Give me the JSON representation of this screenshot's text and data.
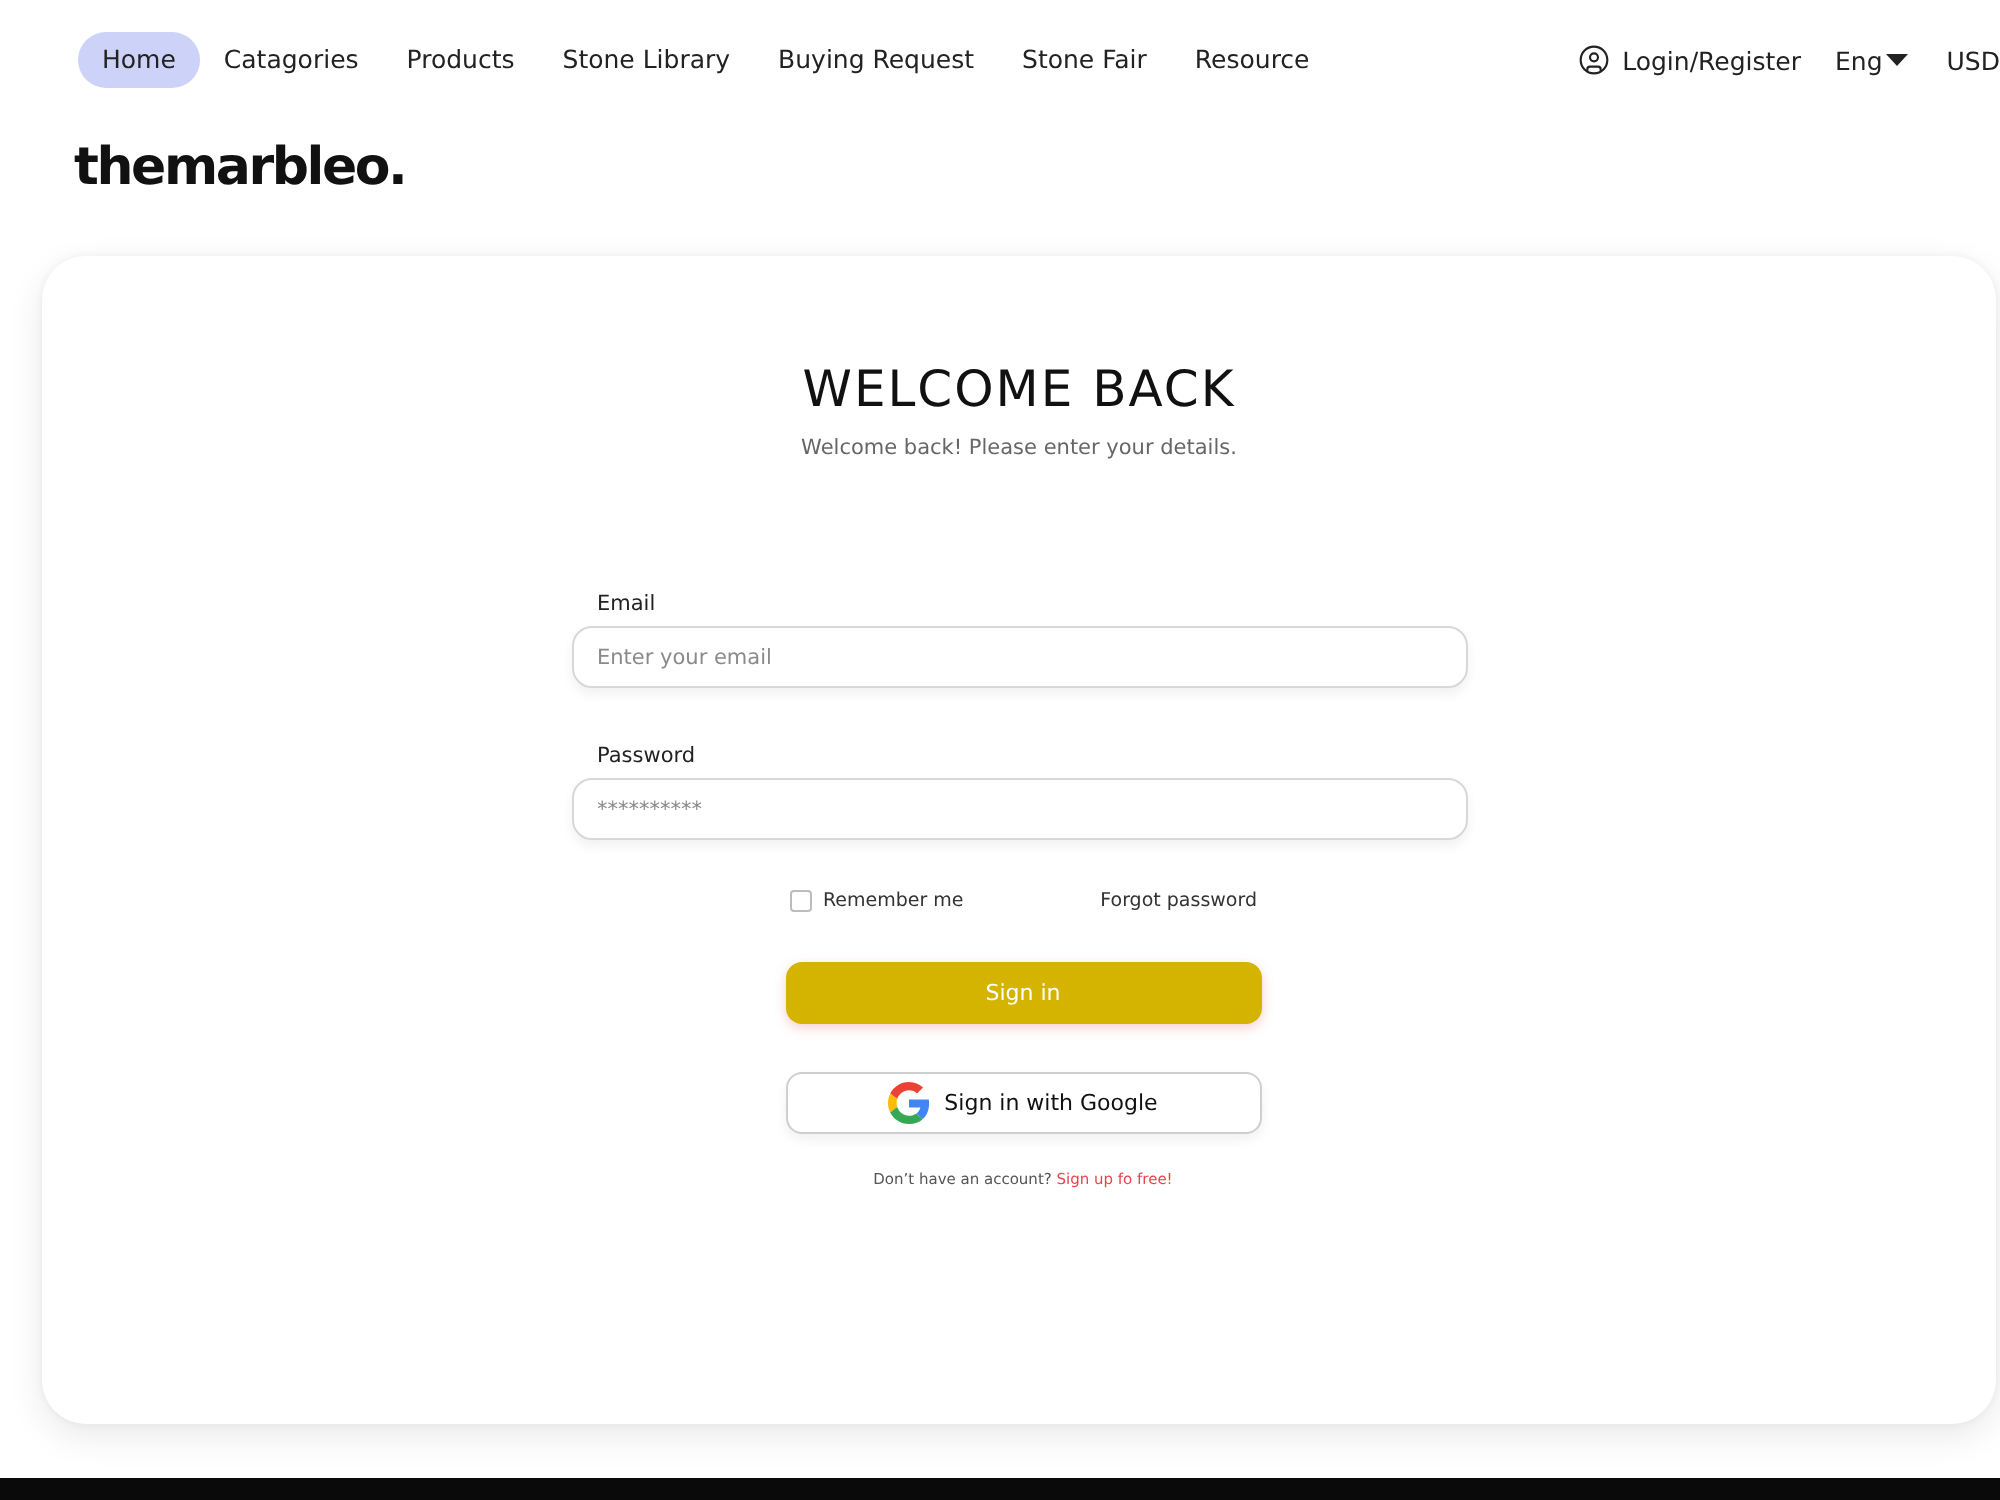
{
  "nav": {
    "items": [
      {
        "label": "Home",
        "selected": true
      },
      {
        "label": "Catagories",
        "selected": false
      },
      {
        "label": "Products",
        "selected": false
      },
      {
        "label": "Stone Library",
        "selected": false
      },
      {
        "label": "Buying Request",
        "selected": false
      },
      {
        "label": "Stone Fair",
        "selected": false
      },
      {
        "label": "Resource",
        "selected": false
      }
    ],
    "account": {
      "label": "Login/Register"
    },
    "language": {
      "label": "Eng"
    },
    "currency": {
      "label": "USD"
    }
  },
  "logo": {
    "text": "themarbleo."
  },
  "login_card": {
    "title": "WELCOME BACK",
    "subtitle": "Welcome back! Please enter your details.",
    "fields": [
      {
        "label": "Email",
        "placeholder": "Enter your email"
      },
      {
        "label": "Password",
        "placeholder": "**********"
      }
    ],
    "remember": {
      "label": "Remember me",
      "checked": false
    },
    "forgot_link": "Forgot password",
    "sign_in_button": "Sign in",
    "google_button": "Sign in with Google",
    "signup_prompt": {
      "text": "Don’t have an account?",
      "link": "Sign up fo free!"
    }
  }
}
